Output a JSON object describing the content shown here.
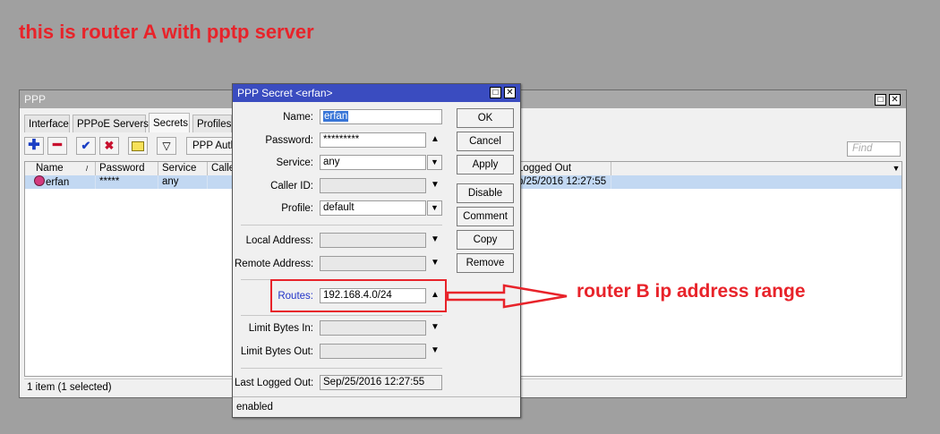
{
  "annotations": {
    "top_note": "this is router A with pptp server",
    "route_note": "router B ip address range",
    "accent_color": "#e8232a"
  },
  "ppp_window": {
    "title": "PPP",
    "tabs": [
      "Interface",
      "PPPoE Servers",
      "Secrets",
      "Profiles"
    ],
    "active_tab": "Secrets",
    "toolbar": {
      "add_icon": "plus-icon",
      "remove_icon": "minus-icon",
      "enable_icon": "check-icon",
      "disable_icon": "x-icon",
      "comment_icon": "note-icon",
      "filter_icon": "filter-icon",
      "auth_button": "PPP Auth"
    },
    "find_placeholder": "Find",
    "columns": [
      "Name",
      "Password",
      "Service",
      "Caller",
      "Logged Out"
    ],
    "rows": [
      {
        "name": "erfan",
        "password": "*****",
        "service": "any",
        "caller": "",
        "logged_out": "p/25/2016 12:27:55"
      }
    ],
    "status": "1 item (1 selected)"
  },
  "secret_dialog": {
    "title": "PPP Secret <erfan>",
    "fields": {
      "name": {
        "label": "Name:",
        "value": "erfan"
      },
      "password": {
        "label": "Password:",
        "value": "*********"
      },
      "service": {
        "label": "Service:",
        "value": "any"
      },
      "caller_id": {
        "label": "Caller ID:",
        "value": ""
      },
      "profile": {
        "label": "Profile:",
        "value": "default"
      },
      "local_address": {
        "label": "Local Address:",
        "value": ""
      },
      "remote_address": {
        "label": "Remote Address:",
        "value": ""
      },
      "routes": {
        "label": "Routes:",
        "value": "192.168.4.0/24"
      },
      "limit_in": {
        "label": "Limit Bytes In:",
        "value": ""
      },
      "limit_out": {
        "label": "Limit Bytes Out:",
        "value": ""
      },
      "last_logged_out": {
        "label": "Last Logged Out:",
        "value": "Sep/25/2016 12:27:55"
      }
    },
    "buttons": [
      "OK",
      "Cancel",
      "Apply",
      "Disable",
      "Comment",
      "Copy",
      "Remove"
    ],
    "status": "enabled"
  }
}
